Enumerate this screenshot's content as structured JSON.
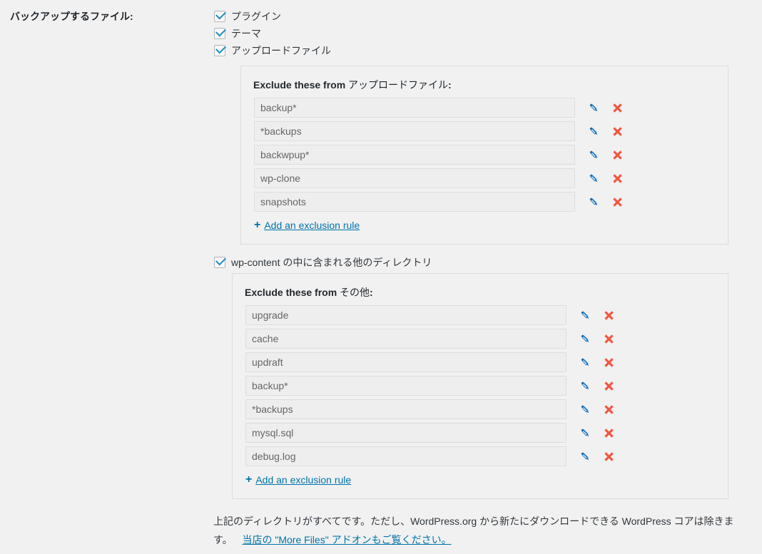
{
  "field_label": "バックアップするファイル:",
  "colors": {
    "page_bg": "#f1f1f1",
    "panel_border": "#dcdcdc",
    "input_bg": "#eeeeee",
    "input_border": "#dddddd",
    "link": "#0073aa",
    "checkbox_check": "#1e8cbe",
    "pencil_icon": "#1e73be",
    "delete_icon": "#f1563f",
    "text": "#32373c",
    "heading": "#23282d"
  },
  "checkboxes": [
    {
      "label": "プラグイン",
      "checked": true,
      "name": "backup-plugins"
    },
    {
      "label": "テーマ",
      "checked": true,
      "name": "backup-themes"
    },
    {
      "label": "アップロードファイル",
      "checked": true,
      "name": "backup-uploads"
    }
  ],
  "wp_content_checkbox": {
    "label": "wp-content の中に含まれる他のディレクトリ",
    "checked": true,
    "name": "backup-wpcontent-others"
  },
  "panels": [
    {
      "name": "uploads-exclusions",
      "title_prefix": "Exclude these from ",
      "title_target": "アップロードファイル",
      "title_suffix": ":",
      "rules": [
        "backup*",
        "*backups",
        "backwpup*",
        "wp-clone",
        "snapshots"
      ],
      "add_label": "Add an exclusion rule",
      "add_plus": "+",
      "edit_icon": "pencil-icon",
      "delete_icon": "x-icon"
    },
    {
      "name": "other-exclusions",
      "title_prefix": "Exclude these from ",
      "title_target": "その他",
      "title_suffix": ":",
      "rules": [
        "upgrade",
        "cache",
        "updraft",
        "backup*",
        "*backups",
        "mysql.sql",
        "debug.log"
      ],
      "add_label": "Add an exclusion rule",
      "add_plus": "+",
      "edit_icon": "pencil-icon",
      "delete_icon": "x-icon"
    }
  ],
  "footnote": {
    "text": "上記のディレクトリがすべてです。ただし、WordPress.org から新たにダウンロードできる WordPress コアは除きます。",
    "link_text": "当店の \"More Files\" アドオンもご覧ください。"
  }
}
